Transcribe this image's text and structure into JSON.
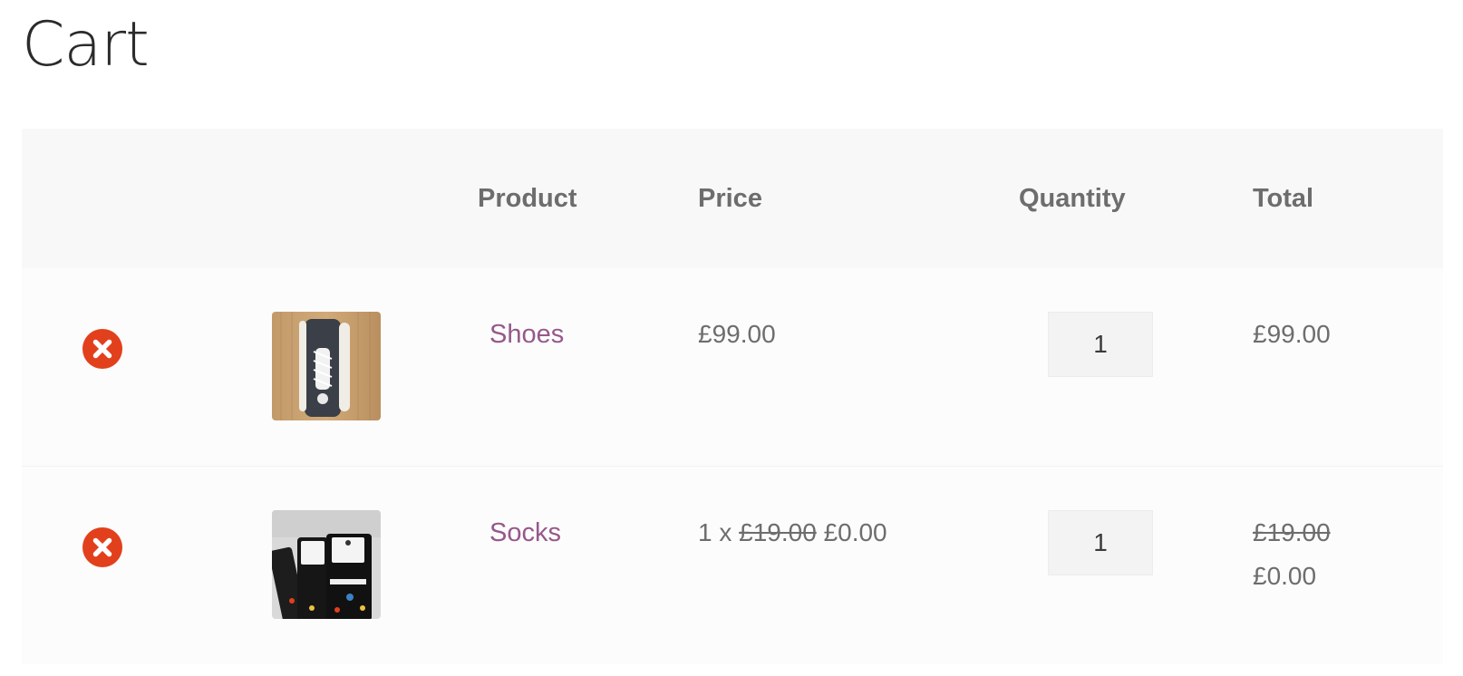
{
  "page": {
    "title": "Cart"
  },
  "colors": {
    "link": "#96588a",
    "remove": "#e2401c",
    "text": "#6d6d6d",
    "header_bg": "#f8f8f8"
  },
  "table": {
    "headers": {
      "product": "Product",
      "price": "Price",
      "quantity": "Quantity",
      "total": "Total"
    }
  },
  "items": [
    {
      "name": "Shoes",
      "price": "£99.00",
      "quantity": "1",
      "total": "£99.00",
      "remove_icon": "close-circle-icon",
      "thumbnail": "shoes-thumbnail"
    },
    {
      "name": "Socks",
      "price_prefix": "1 x",
      "price_original": "£19.00",
      "price_current": "£0.00",
      "quantity": "1",
      "total_original": "£19.00",
      "total_current": "£0.00",
      "remove_icon": "close-circle-icon",
      "thumbnail": "socks-thumbnail"
    }
  ]
}
